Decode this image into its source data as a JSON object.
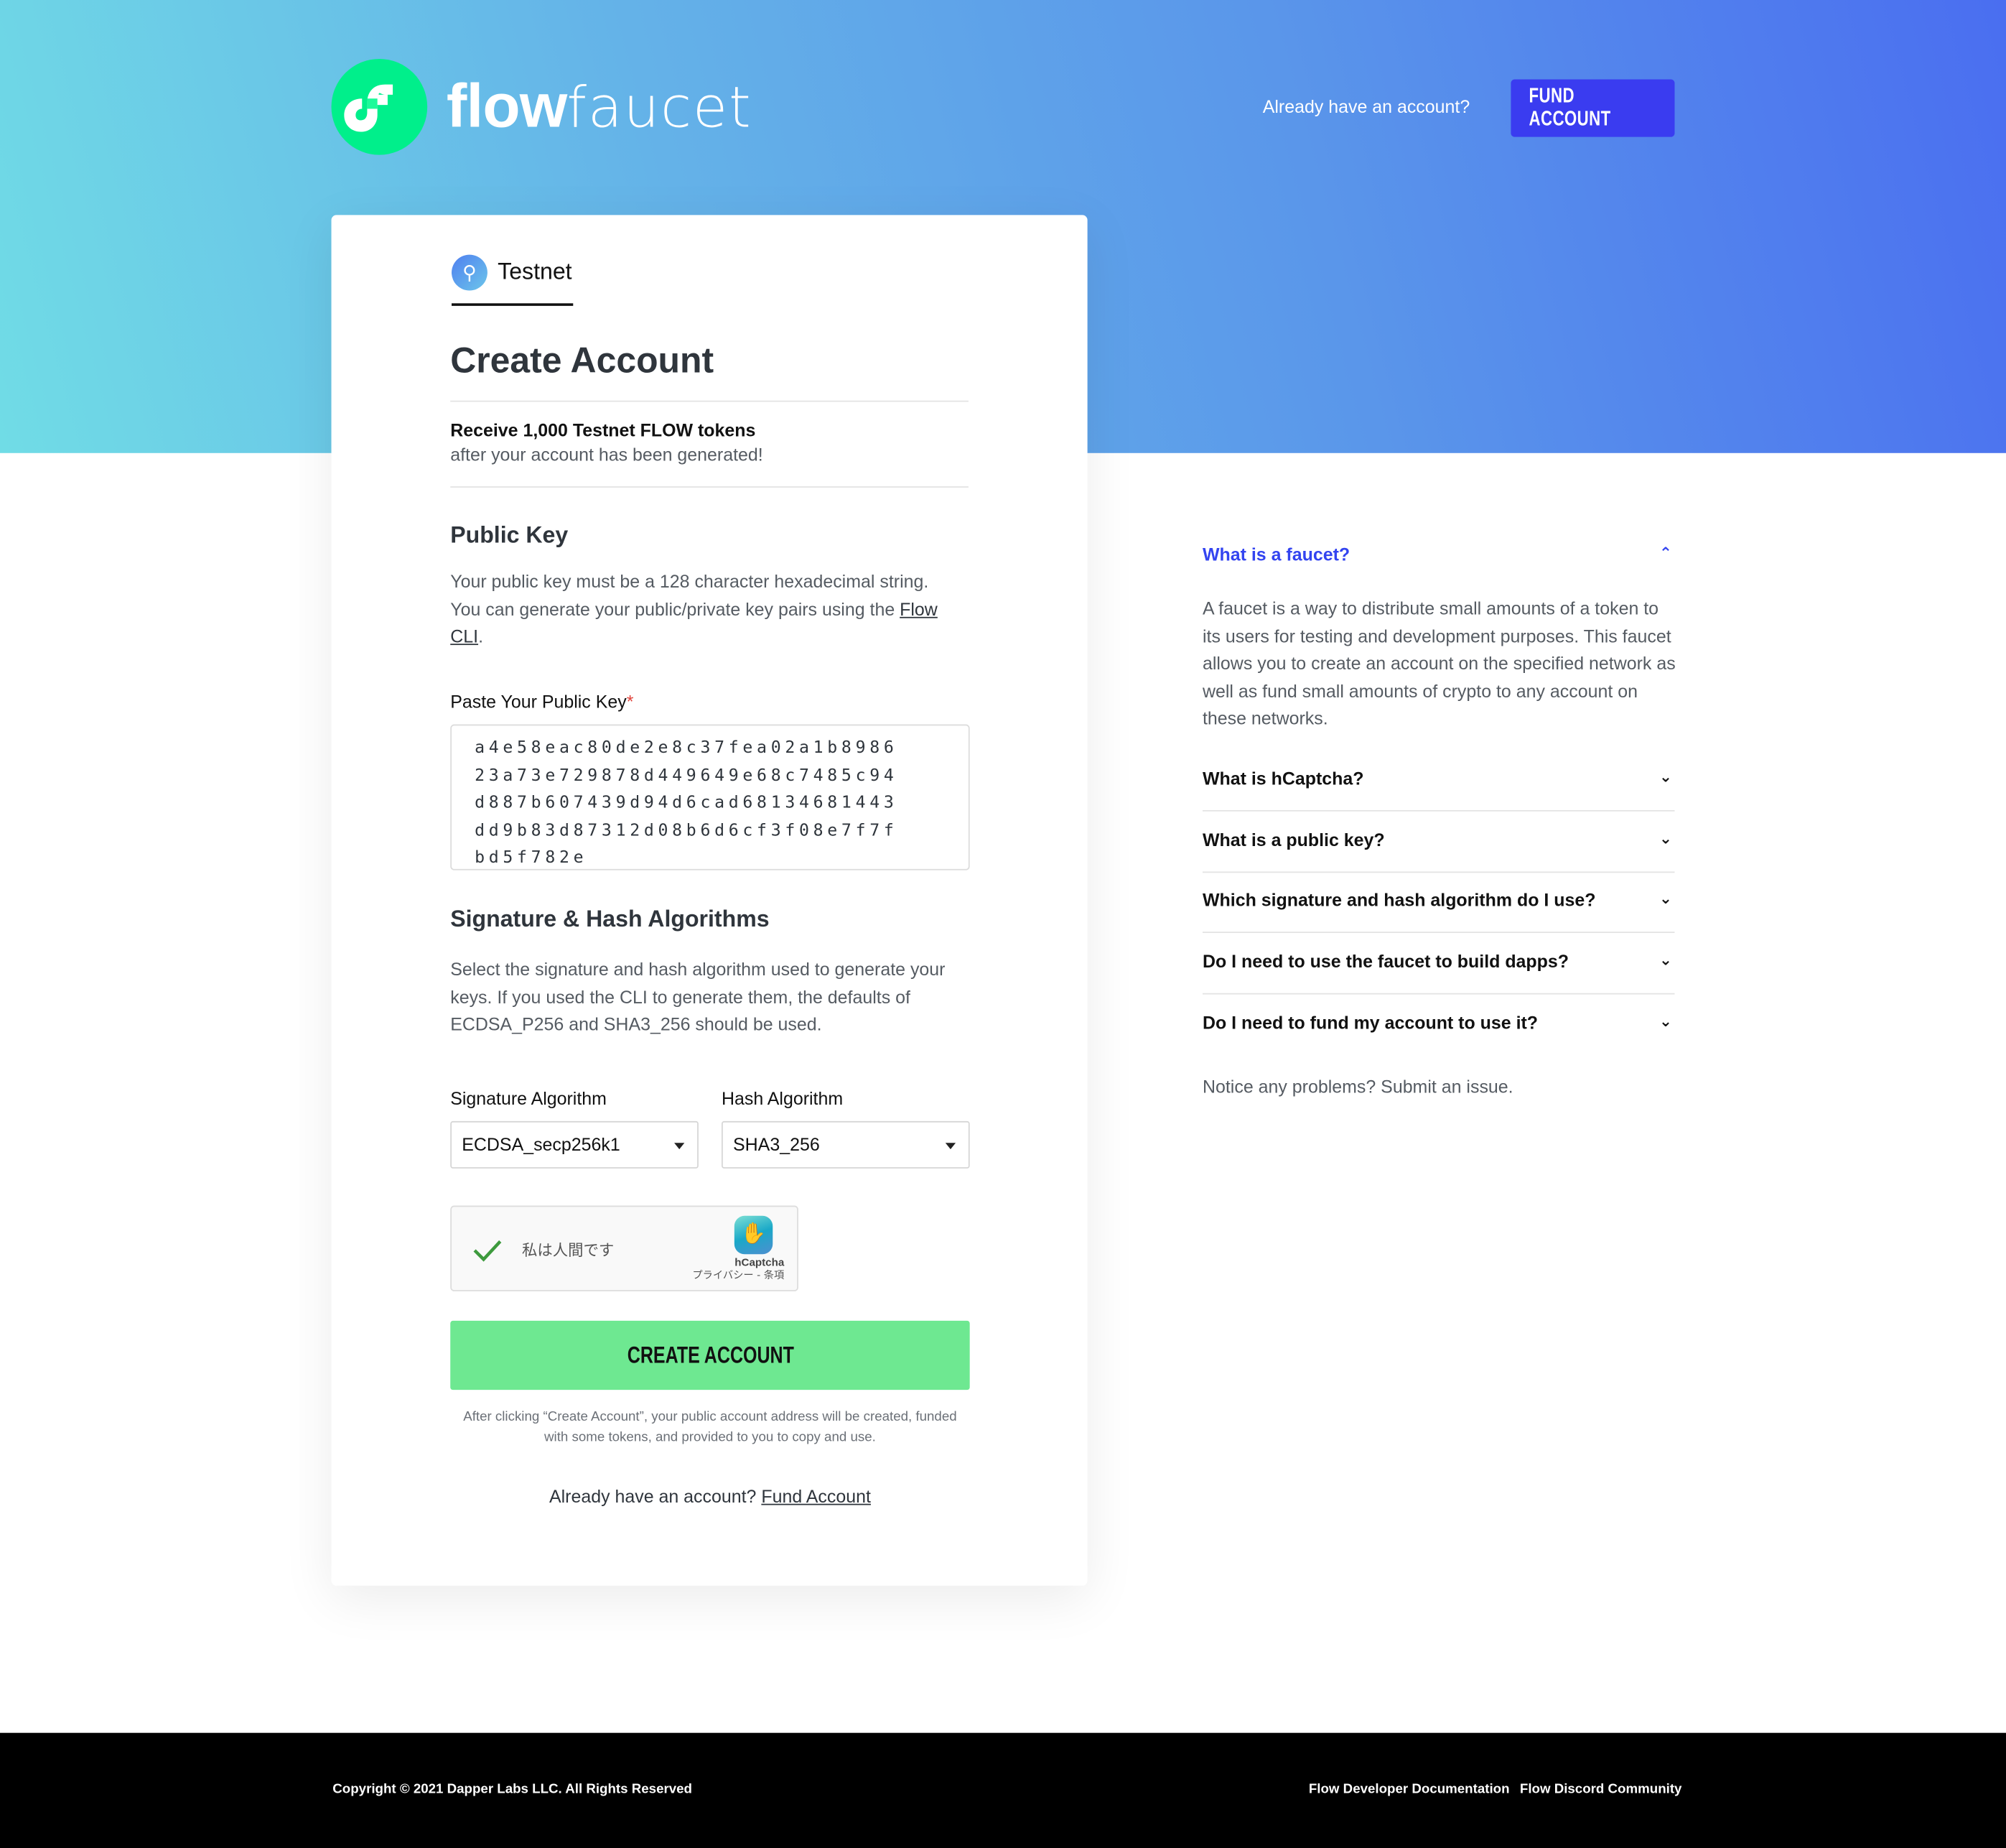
{
  "header": {
    "brand_bold": "flow",
    "brand_light": "faucet",
    "already_text": "Already have an account?",
    "fund_button": "FUND ACCOUNT"
  },
  "card": {
    "tab_label": "Testnet",
    "tab_icon": "faucet-icon",
    "title": "Create Account",
    "receive_title": "Receive 1,000 Testnet FLOW tokens",
    "receive_sub": "after your account has been generated!",
    "public_key": {
      "heading": "Public Key",
      "desc": "Your public key must be a 128 character hexadecimal string. You can generate your public/private key pairs using the ",
      "link": "Flow CLI",
      "desc_end": ".",
      "label": "Paste Your Public Key",
      "required_mark": "*",
      "value": "a4e58eac80de2e8c37fea02a1b898623a73e729878d449649e68c7485c94d887b607439d94d6cad68134681443dd9b83d87312d08b6d6cf3f08e7f7fbd5f782e"
    },
    "algorithms": {
      "heading": "Signature & Hash Algorithms",
      "desc": "Select the signature and hash algorithm used to generate your keys. If you used the CLI to generate them, the defaults of ECDSA_P256 and SHA3_256 should be used.",
      "signature_label": "Signature Algorithm",
      "signature_value": "ECDSA_secp256k1",
      "hash_label": "Hash Algorithm",
      "hash_value": "SHA3_256"
    },
    "captcha": {
      "label": "私は人間です",
      "brand": "hCaptcha",
      "links": "プライバシー - 条項"
    },
    "create_button": "CREATE ACCOUNT",
    "disclaimer": "After clicking “Create Account”, your public account address will be created, funded with some tokens, and provided to you to copy and use.",
    "already_text": "Already have an account?",
    "fund_link": "Fund Account"
  },
  "faq": {
    "open_question": "What is a faucet?",
    "open_answer": "A faucet is a way to distribute small amounts of a token to its users for testing and development purposes. This faucet allows you to create an account on the specified network as well as fund small amounts of crypto to any account on these networks.",
    "questions": [
      "What is hCaptcha?",
      "What is a public key?",
      "Which signature and hash algorithm do I use?",
      "Do I need to use the faucet to build dapps?",
      "Do I need to fund my account to use it?"
    ],
    "notice": "Notice any problems? Submit an issue."
  },
  "footer": {
    "copyright": "Copyright © 2021 Dapper Labs LLC. All Rights Reserved",
    "links": [
      "Flow Developer Documentation",
      "Flow Discord Community"
    ]
  },
  "colors": {
    "accent": "#3a3cf0",
    "create_button": "#6ee891",
    "logo_green": "#00ef8b"
  }
}
